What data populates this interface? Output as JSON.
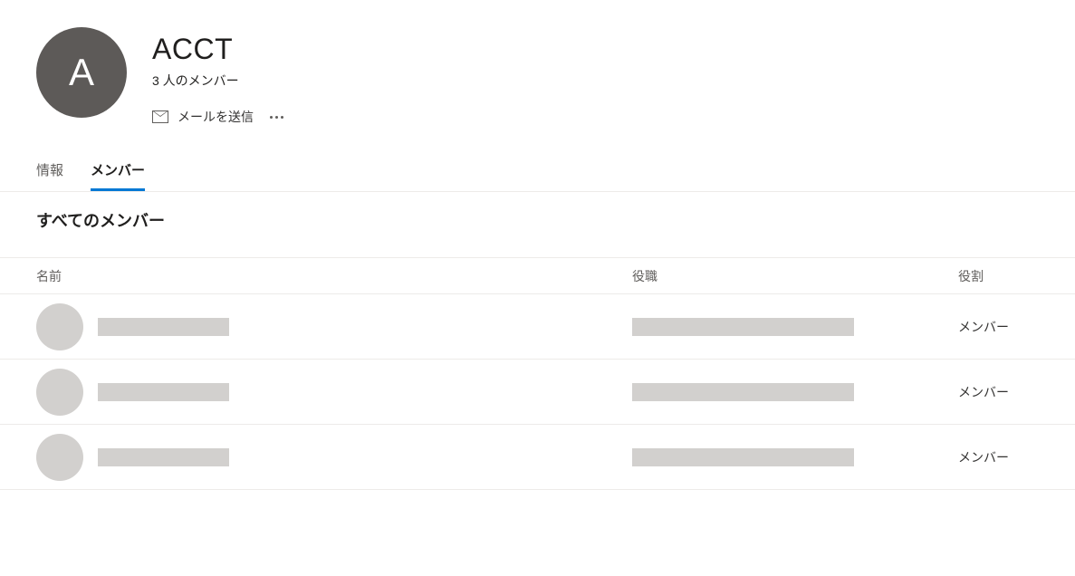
{
  "group": {
    "avatar_letter": "A",
    "title": "ACCT",
    "member_count": "3 人のメンバー"
  },
  "actions": {
    "send_mail": "メールを送信"
  },
  "tabs": {
    "info": "情報",
    "members": "メンバー"
  },
  "section": {
    "title": "すべてのメンバー"
  },
  "columns": {
    "name": "名前",
    "position": "役職",
    "role": "役割"
  },
  "members": [
    {
      "role": "メンバー"
    },
    {
      "role": "メンバー"
    },
    {
      "role": "メンバー"
    }
  ]
}
